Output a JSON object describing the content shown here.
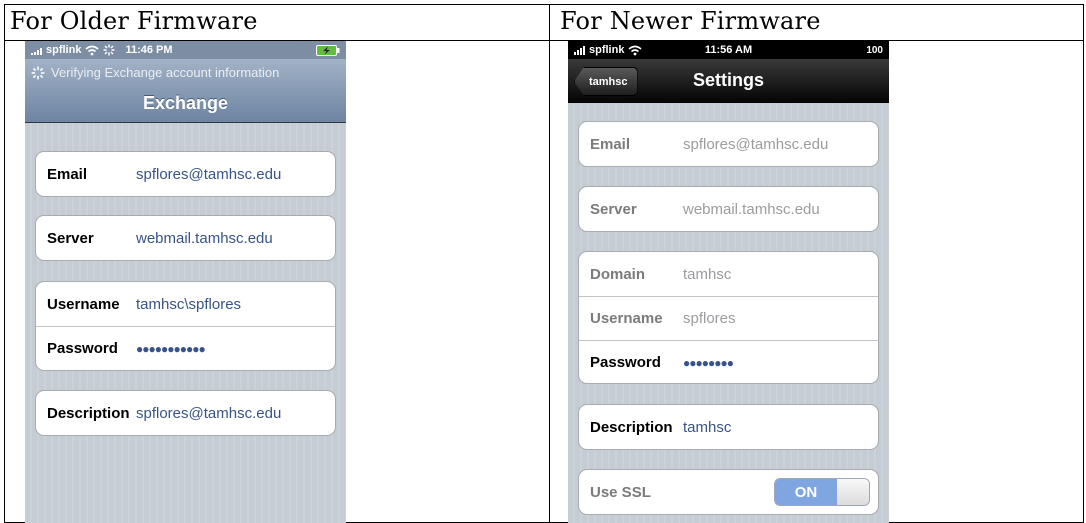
{
  "columns": [
    {
      "title": "For Older Firmware"
    },
    {
      "title": "For Newer Firmware"
    }
  ],
  "older": {
    "status": {
      "carrier": "spflink",
      "time": "11:46 PM"
    },
    "verifying_text": "Verifying Exchange account information",
    "nav_title": "Exchange",
    "fields": {
      "email": {
        "label": "Email",
        "value": "spflores@tamhsc.edu"
      },
      "server": {
        "label": "Server",
        "value": "webmail.tamhsc.edu"
      },
      "username": {
        "label": "Username",
        "value": "tamhsc\\spflores"
      },
      "password": {
        "label": "Password",
        "value": "●●●●●●●●●●●"
      },
      "description": {
        "label": "Description",
        "value": "spflores@tamhsc.edu"
      }
    }
  },
  "newer": {
    "status": {
      "carrier": "spflink",
      "time": "11:56 AM",
      "battery": "100"
    },
    "back_label": "tamhsc",
    "nav_title": "Settings",
    "fields": {
      "email": {
        "label": "Email",
        "value": "spflores@tamhsc.edu"
      },
      "server": {
        "label": "Server",
        "value": "webmail.tamhsc.edu"
      },
      "domain": {
        "label": "Domain",
        "value": "tamhsc"
      },
      "username": {
        "label": "Username",
        "value": "spflores"
      },
      "password": {
        "label": "Password",
        "value": "●●●●●●●●"
      },
      "description": {
        "label": "Description",
        "value": "tamhsc"
      },
      "ssl": {
        "label": "Use SSL",
        "value": "ON"
      }
    }
  },
  "colors": {
    "accent_text": "#385487",
    "toggle_on": "#7fa6e0",
    "nav_blue": "#6d84a2"
  }
}
